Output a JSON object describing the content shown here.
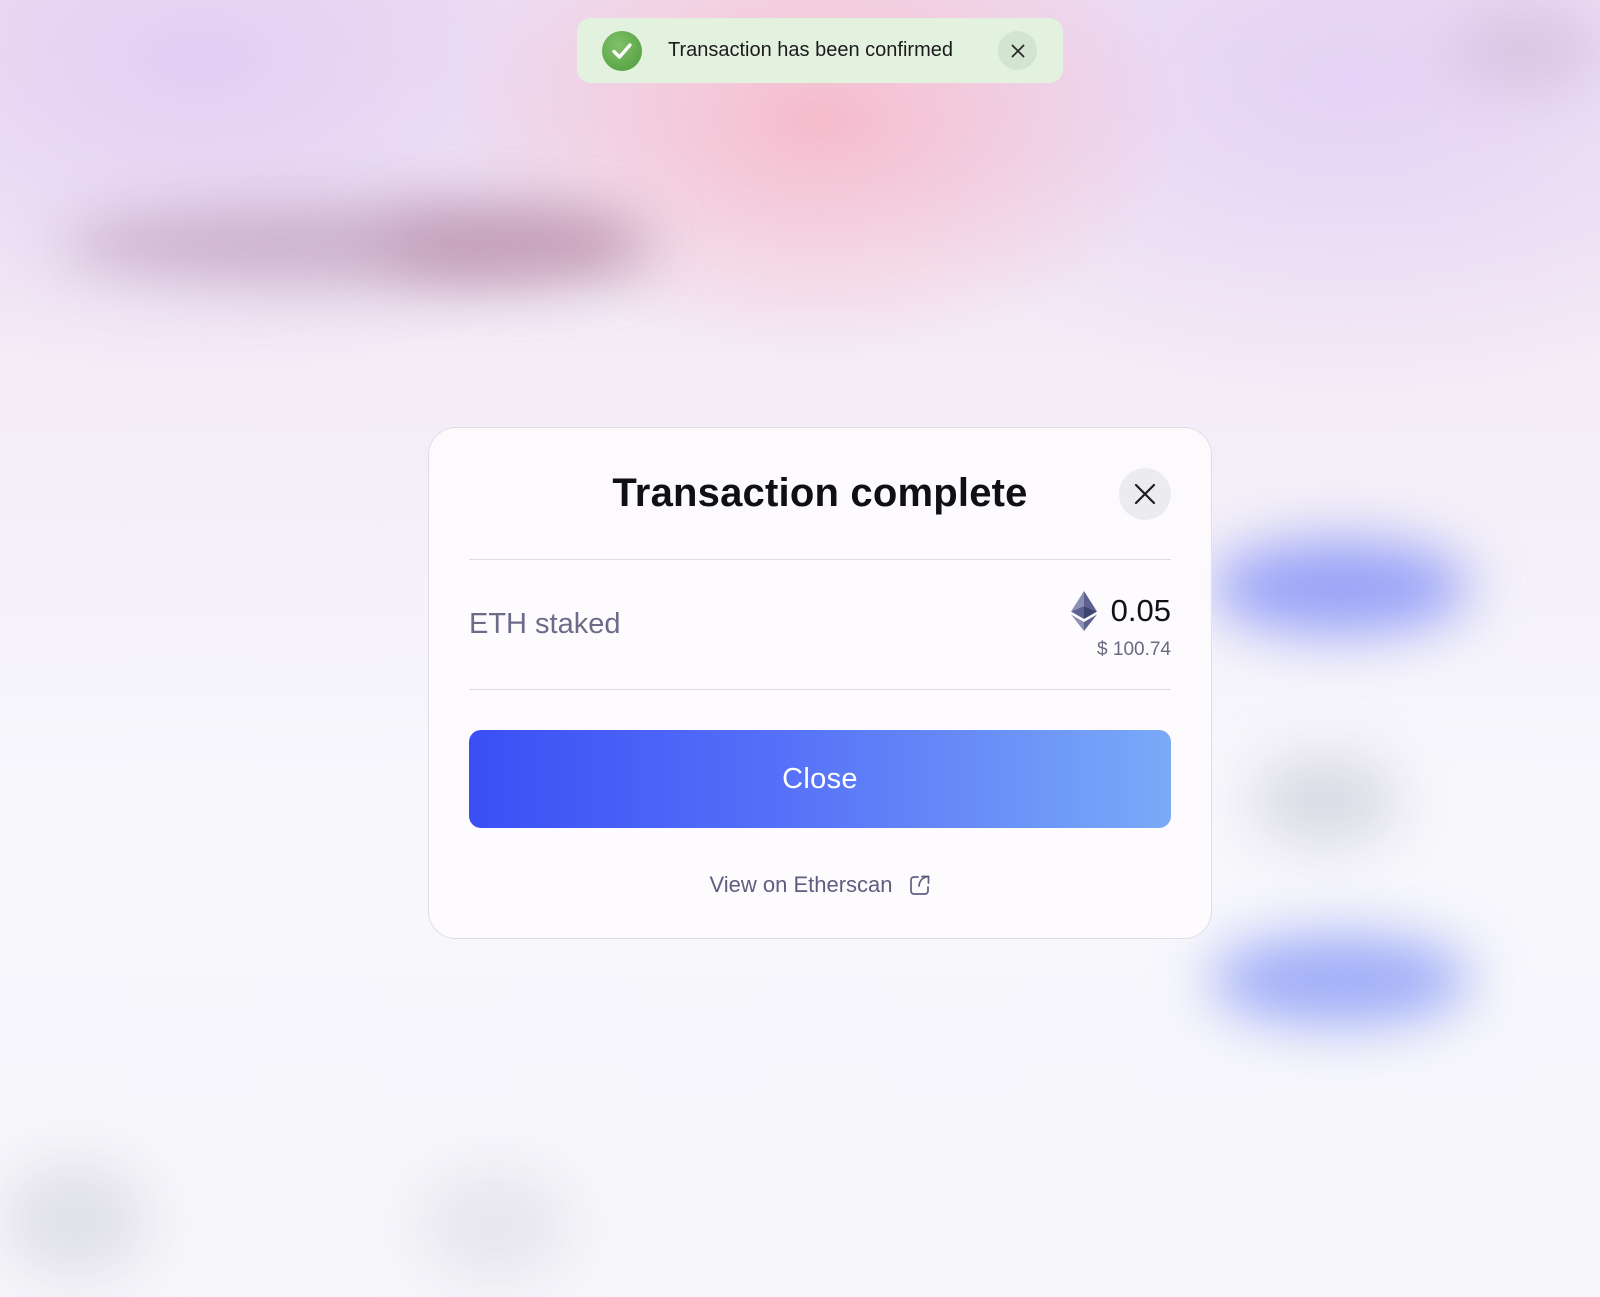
{
  "toast": {
    "message": "Transaction has been confirmed",
    "status_color": "#5ea648",
    "icons": {
      "status": "check-circle-icon",
      "close": "close-icon"
    }
  },
  "modal": {
    "title": "Transaction complete",
    "close_icon": "close-icon",
    "staked": {
      "label": "ETH staked",
      "amount": "0.05",
      "fiat": "$ 100.74",
      "token_icon": "ethereum-icon"
    },
    "primary_button": {
      "label": "Close",
      "gradient": [
        "#3a4ff5",
        "#7aaaf8"
      ]
    },
    "link": {
      "label": "View on Etherscan",
      "icon": "external-link-icon"
    }
  }
}
